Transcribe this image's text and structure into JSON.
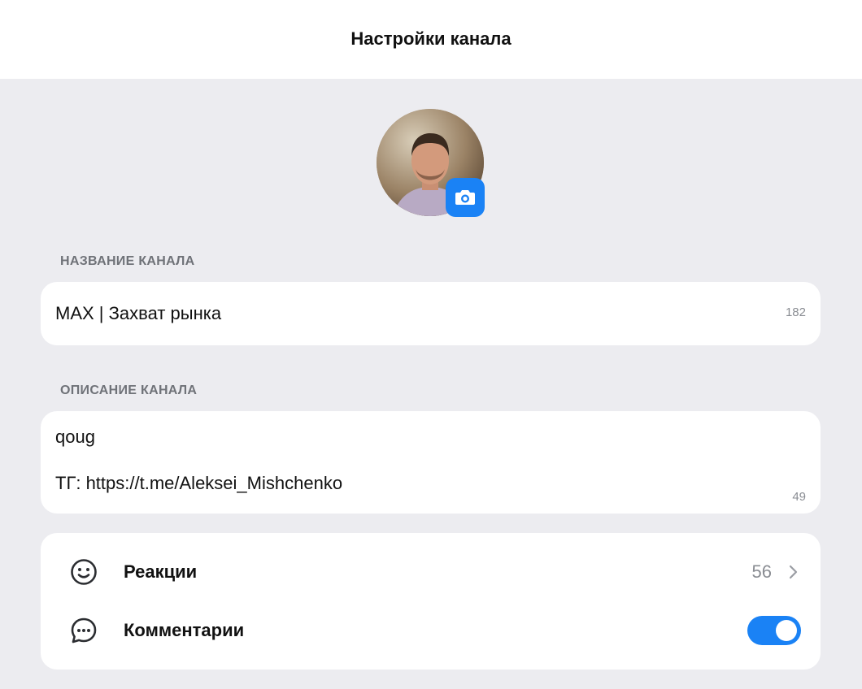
{
  "header": {
    "title": "Настройки канала"
  },
  "avatar": {
    "camera_icon": "camera-icon"
  },
  "name_section": {
    "label": "НАЗВАНИЕ КАНАЛА",
    "value": "MAX | Захват рынка",
    "counter": "182"
  },
  "description_section": {
    "label": "ОПИСАНИЕ КАНАЛА",
    "lines": [
      "qoug",
      "ТГ: https://t.me/Aleksei_Mishchenko"
    ],
    "counter": "49"
  },
  "settings": {
    "reactions": {
      "icon": "smiley-icon",
      "label": "Реакции",
      "count": "56"
    },
    "comments": {
      "icon": "chat-bubble-icon",
      "label": "Комментарии",
      "enabled": true
    }
  },
  "colors": {
    "accent": "#1a82f5",
    "background": "#ececf0",
    "card": "#ffffff",
    "muted": "#8a8d93"
  }
}
